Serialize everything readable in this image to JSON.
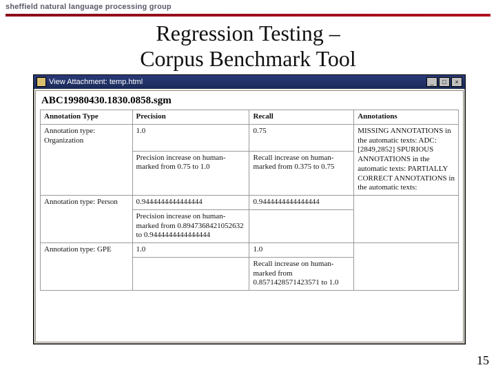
{
  "header": {
    "group": "sheffield natural language processing group"
  },
  "slide": {
    "title_line1": "Regression Testing –",
    "title_line2": "Corpus Benchmark Tool",
    "number": "15"
  },
  "window": {
    "title": "View Attachment: temp.html",
    "min_glyph": "_",
    "max_glyph": "□",
    "close_glyph": "×",
    "doc_title": "ABC19980430.1830.0858.sgm",
    "columns": {
      "c1": "Annotation Type",
      "c2": "Precision",
      "c3": "Recall",
      "c4": "Annotations"
    },
    "rows": [
      {
        "type": "Annotation type: Organization",
        "precision_val": "1.0",
        "precision_note": "Precision increase on human-marked from 0.75 to 1.0",
        "recall_val": "0.75",
        "recall_note": "Recall increase on human-marked from 0.375 to 0.75",
        "annotations": "MISSING ANNOTATIONS in the automatic texts: ADC: [2849,2852] SPURIOUS ANNOTATIONS in the automatic texts: PARTIALLY CORRECT ANNOTATIONS in the automatic texts:"
      },
      {
        "type": "Annotation type: Person",
        "precision_val": "0.9444444444444444",
        "precision_note": "Precision increase on human-marked from 0.8947368421052632 to 0.9444444444444444",
        "recall_val": "0.9444444444444444",
        "recall_note": "",
        "annotations": ""
      },
      {
        "type": "Annotation type: GPE",
        "precision_val": "1.0",
        "precision_note": "",
        "recall_val": "1.0",
        "recall_note": "Recall increase on human-marked from 0.8571428571423571 to 1.0",
        "annotations": ""
      }
    ]
  }
}
